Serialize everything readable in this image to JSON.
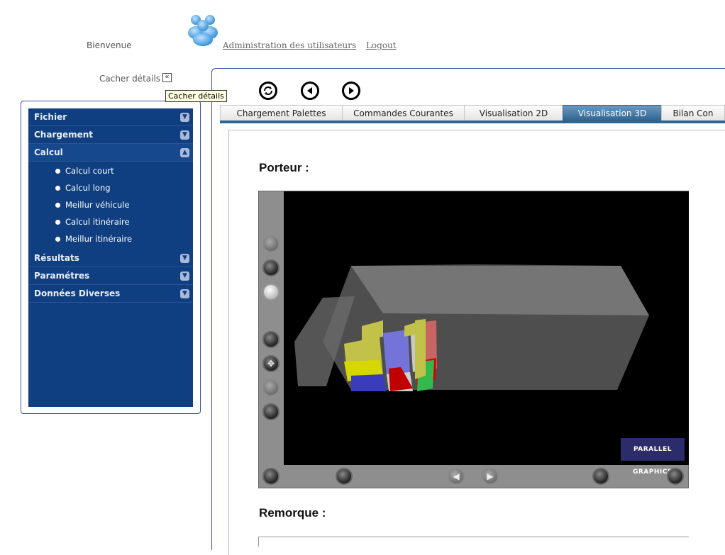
{
  "header": {
    "welcome": "Bienvenue",
    "links": [
      {
        "label": "Administration des utilisateurs"
      },
      {
        "label": "Logout"
      }
    ],
    "hide_details": "Cacher détails",
    "collapse_glyph": "«",
    "tooltip": "Cacher détails",
    "users_icon": "users-icon"
  },
  "sidebar": {
    "sections": [
      {
        "label": "Fichier",
        "open": false
      },
      {
        "label": "Chargement",
        "open": false
      },
      {
        "label": "Calcul",
        "open": true,
        "items": [
          {
            "label": "Calcul court"
          },
          {
            "label": "Calcul long"
          },
          {
            "label": "Meillur véhicule"
          },
          {
            "label": "Calcul itinéraire"
          },
          {
            "label": "Meillur itinéraire"
          }
        ]
      },
      {
        "label": "Résultats",
        "open": false
      },
      {
        "label": "Paramétres",
        "open": false
      },
      {
        "label": "Données Diverses",
        "open": false
      }
    ]
  },
  "toolbar": {
    "buttons": [
      "refresh-icon",
      "previous-icon",
      "next-icon"
    ]
  },
  "tabs": [
    {
      "label": "Chargement Palettes"
    },
    {
      "label": "Commandes Courantes"
    },
    {
      "label": "Visualisation 2D"
    },
    {
      "label": "Visualisation 3D",
      "active": true
    },
    {
      "label": "Bilan Con"
    }
  ],
  "content": {
    "porteur_title": "Porteur :",
    "remorque_title": "Remorque :",
    "viewer_logo": "PARALLEL GRAPHICS"
  },
  "colors": {
    "menu_bg": "#0f3f80",
    "active_tab": "#2f6591",
    "panel_border": "#3a4fa8"
  }
}
